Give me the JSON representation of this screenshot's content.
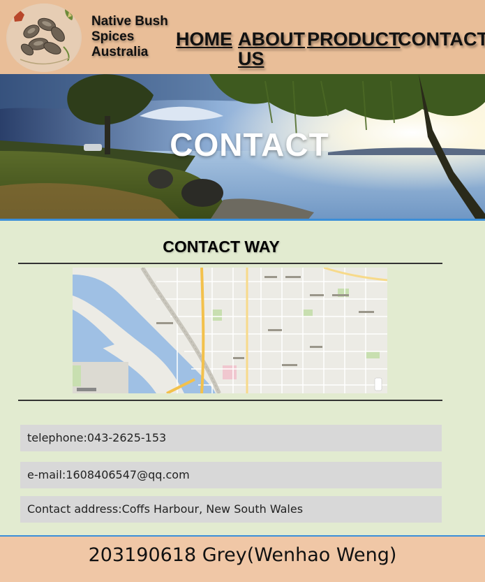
{
  "header": {
    "brand": "Native Bush Spices Australia",
    "logo_icon": "spice-seeds-logo-icon"
  },
  "nav": {
    "items": [
      {
        "label": "HOME"
      },
      {
        "label": "ABOUT US"
      },
      {
        "label": "PRODUCT"
      },
      {
        "label": "CONTACT"
      }
    ]
  },
  "hero": {
    "title": "CONTACT",
    "image": "lakeside-sunset-photo"
  },
  "contact": {
    "heading": "CONTACT WAY",
    "map": "street-map-image",
    "telephone": "telephone:043-2625-153",
    "email": "e-mail:1608406547@qq.com",
    "address": "Contact address:Coffs Harbour, New South Wales"
  },
  "footer": {
    "text": "203190618 Grey(Wenhao Weng)"
  },
  "colors": {
    "header_bg": "#e9be98",
    "body_bg": "#e2ebd0",
    "footer_bg": "#f0c7a6",
    "accent_line": "#3b8ed8",
    "info_box_bg": "#d8d8d8"
  }
}
